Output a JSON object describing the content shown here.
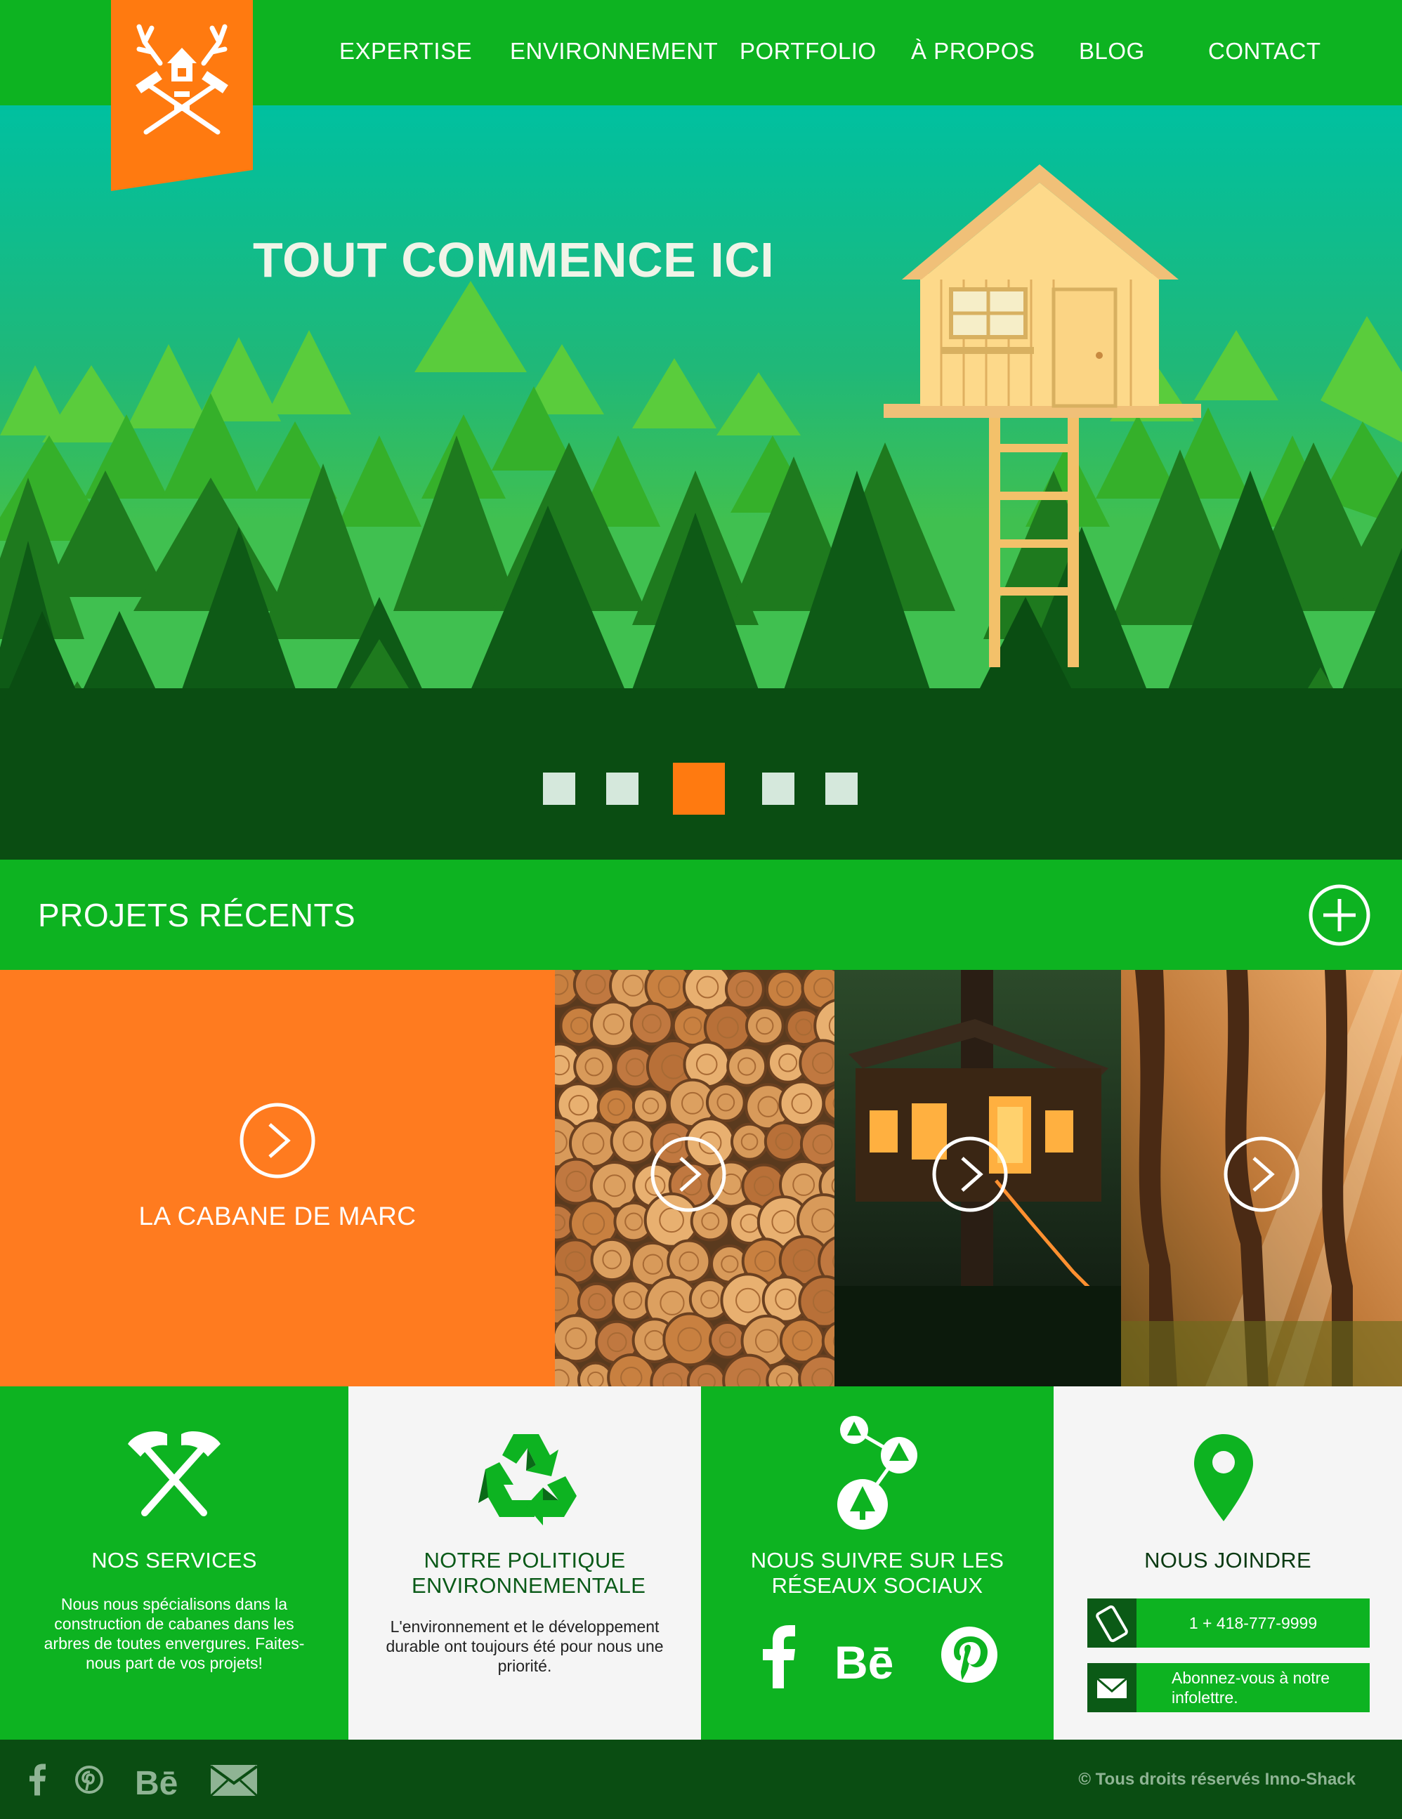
{
  "nav": {
    "items": [
      "EXPERTISE",
      "ENVIRONNEMENT",
      "PORTFOLIO",
      "À PROPOS",
      "BLOG",
      "CONTACT"
    ]
  },
  "colors": {
    "primary_green": "#0db321",
    "dark_green": "#0a4d12",
    "accent_orange": "#ff7a10",
    "light_panel": "#f5f5f5"
  },
  "hero": {
    "title": "TOUT COMMENCE ICI",
    "slide_count": 5,
    "active_slide": 3
  },
  "recent": {
    "title": "PROJETS RÉCENTS",
    "projects": [
      {
        "label": "LA CABANE DE MARC"
      }
    ]
  },
  "info": {
    "services": {
      "icon": "crossed-hammers-icon",
      "title": "NOS SERVICES",
      "text": "Nous nous spécialisons dans la construction de cabanes dans les arbres de toutes envergures. Faites-nous part de vos projets!"
    },
    "policy": {
      "icon": "recycle-icon",
      "title": "NOTRE POLITIQUE ENVIRONNEMENTALE",
      "text": "L'environnement et le développement durable ont toujours été pour nous une priorité."
    },
    "social": {
      "icon": "social-network-icon",
      "title": "NOUS SUIVRE SUR LES RÉSEAUX SOCIAUX",
      "links": [
        "facebook-icon",
        "behance-icon",
        "pinterest-icon"
      ]
    },
    "contact": {
      "icon": "location-pin-icon",
      "title": "NOUS JOINDRE",
      "phone": "1 + 418-777-9999",
      "newsletter": "Abonnez-vous à notre infolettre."
    }
  },
  "footer": {
    "copyright": "© Tous droits réservés Inno-Shack"
  }
}
